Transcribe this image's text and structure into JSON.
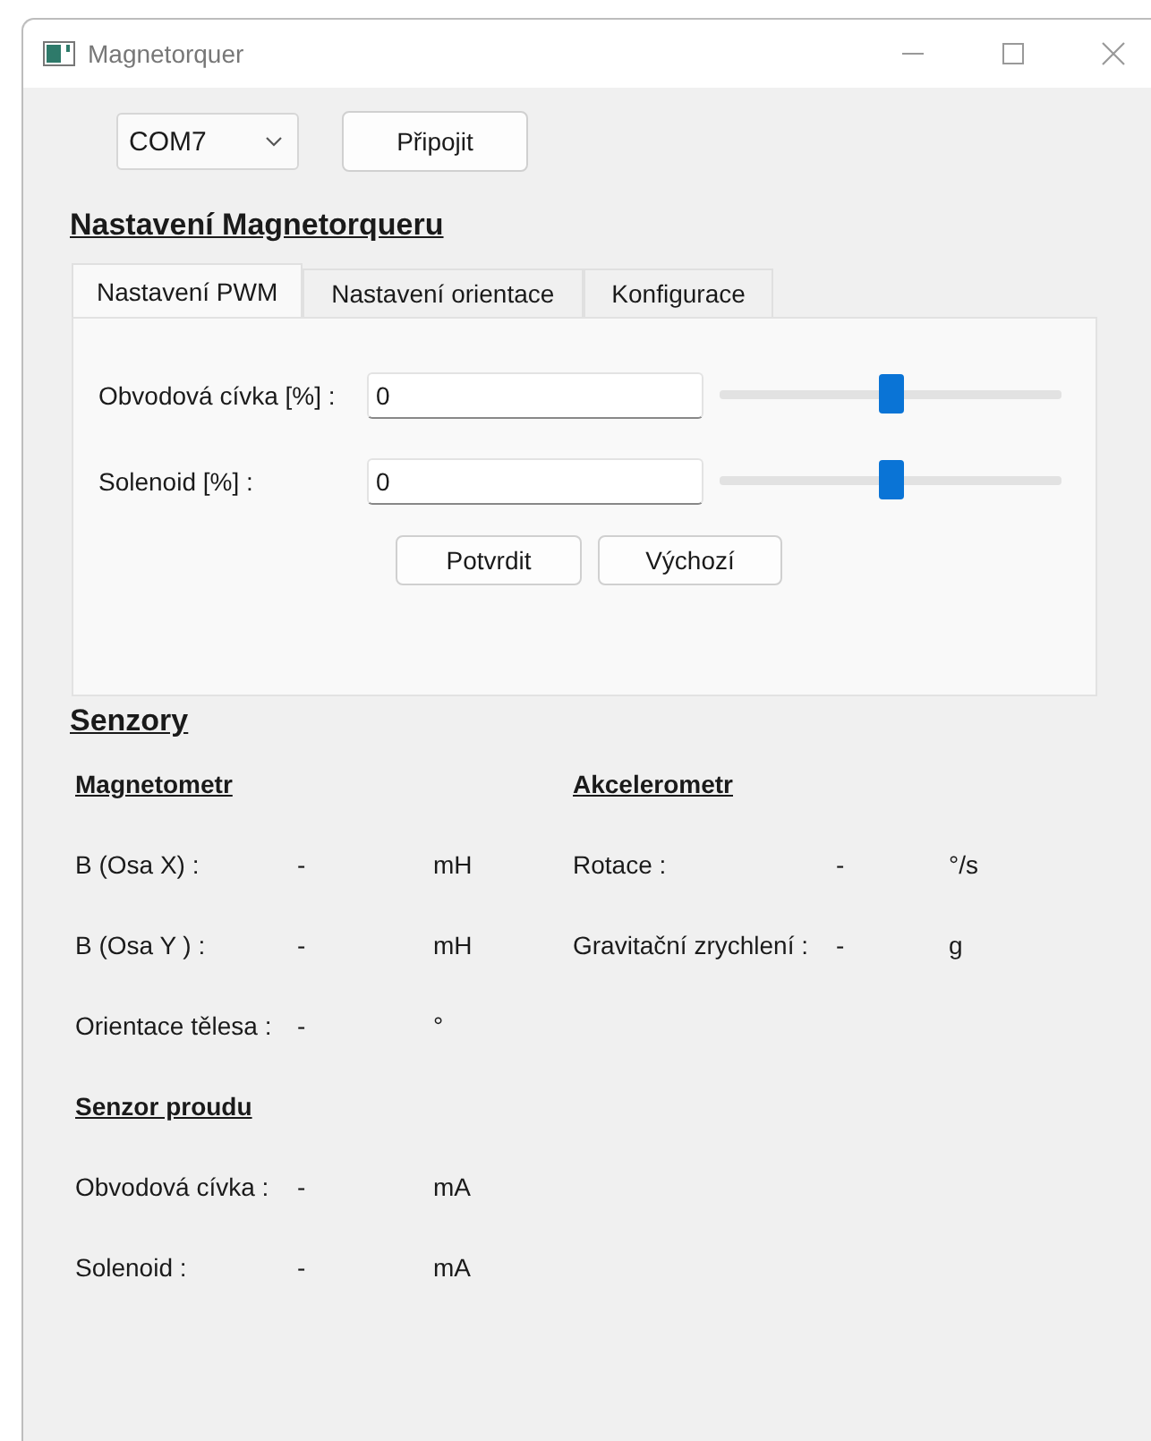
{
  "window": {
    "title": "Magnetorquer"
  },
  "port": {
    "value": "COM7"
  },
  "connect_button": "Připojit",
  "settings": {
    "heading": "Nastavení Magnetorqueru",
    "tabs": [
      {
        "label": "Nastavení PWM",
        "selected": true
      },
      {
        "label": "Nastavení orientace",
        "selected": false
      },
      {
        "label": "Konfigurace",
        "selected": false
      }
    ],
    "rows": [
      {
        "label": "Obvodová cívka [%] :",
        "value": "0",
        "level": 0.5
      },
      {
        "label": "Solenoid [%] :",
        "value": "0",
        "level": 0.5
      }
    ],
    "buttons": [
      "Potvrdit",
      "Výchozí"
    ]
  },
  "sensors": {
    "heading": "Senzory",
    "columns": [
      {
        "groups": [
          {
            "title": "Magnetometr",
            "rows": [
              {
                "label": "B (Osa X) :",
                "value": "-",
                "unit": "mH"
              },
              {
                "label": "B (Osa Y ) :",
                "value": "-",
                "unit": "mH"
              },
              {
                "label": "Orientace tělesa :",
                "value": "-",
                "unit": "°"
              }
            ]
          },
          {
            "title": "Senzor proudu",
            "rows": [
              {
                "label": "Obvodová cívka :",
                "value": "-",
                "unit": "mA"
              },
              {
                "label": "Solenoid :",
                "value": "-",
                "unit": "mA"
              }
            ]
          }
        ]
      },
      {
        "groups": [
          {
            "title": "Akcelerometr",
            "rows": [
              {
                "label": "Rotace :",
                "value": "-",
                "unit": "°/s"
              },
              {
                "label": "Gravitační zrychlení :",
                "value": "-",
                "unit": "g"
              }
            ]
          }
        ]
      }
    ]
  }
}
